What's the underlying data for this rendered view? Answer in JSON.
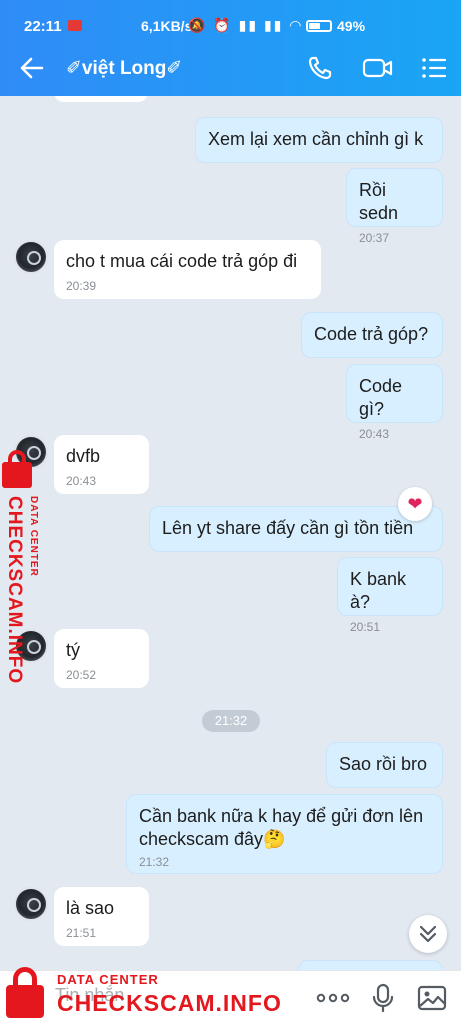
{
  "status_bar": {
    "time": "22:11",
    "network_speed": "6,1KB/s",
    "status_icons": "🔕 ⏰ ▮▮ ▮▮ ◠",
    "battery": "49%"
  },
  "header": {
    "title": "✐việt Long✐"
  },
  "messages": [
    {
      "side": "me",
      "text": "Xem lại xem cần chỉnh gì k",
      "time": ""
    },
    {
      "side": "me",
      "text": "Rồi sedn",
      "time": "20:37"
    },
    {
      "side": "them",
      "text": "cho t mua cái code trả góp đi",
      "time": "20:39"
    },
    {
      "side": "me",
      "text": "Code trả góp?",
      "time": ""
    },
    {
      "side": "me",
      "text": "Code gì?",
      "time": "20:43"
    },
    {
      "side": "them",
      "text": "dvfb",
      "time": "20:43"
    },
    {
      "side": "me",
      "text": "Lên yt share đấy cần gì tồn tiền",
      "time": ""
    },
    {
      "side": "me",
      "text": "K bank à?",
      "time": "20:51"
    },
    {
      "side": "them",
      "text": "tý",
      "time": "20:52"
    },
    {
      "side": "me",
      "text": "Sao rồi bro",
      "time": ""
    },
    {
      "side": "me",
      "text": "Cần bank nữa k hay để gửi đơn lên checkscam đây🤔",
      "time": "21:32"
    },
    {
      "side": "them",
      "text": "là sao",
      "time": "21:51"
    }
  ],
  "time_separator": "21:32",
  "reaction": "❤",
  "composer": {
    "placeholder": "Tin nhắn",
    "more_label": "ooo"
  },
  "watermark": {
    "brand": "CHECKSCAM.INFO",
    "tagline": "DATA CENTER"
  },
  "colors": {
    "header": "#2f8cf7",
    "my_bubble": "#d8efff",
    "their_bubble": "#ffffff",
    "background": "#e2e9f1",
    "watermark": "#e3171d"
  }
}
